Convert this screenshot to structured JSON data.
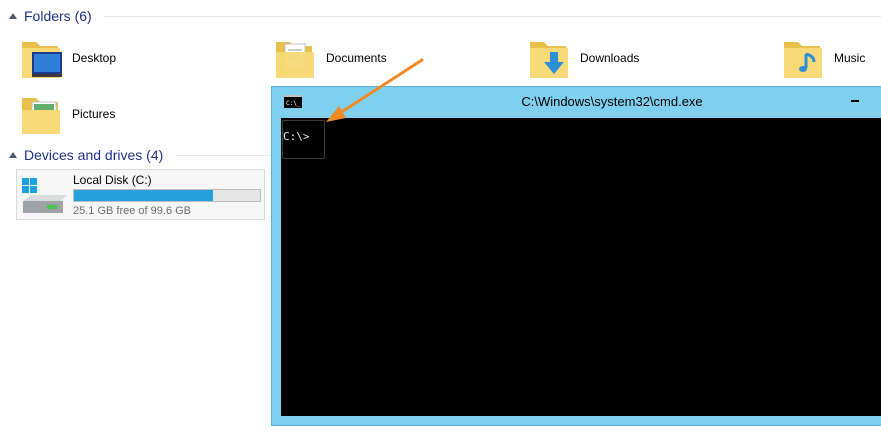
{
  "folders_section": {
    "header": "Folders (6)",
    "items": [
      {
        "name": "Desktop",
        "icon": "folder-desktop-icon"
      },
      {
        "name": "Documents",
        "icon": "folder-documents-icon"
      },
      {
        "name": "Downloads",
        "icon": "folder-downloads-icon"
      },
      {
        "name": "Music",
        "icon": "folder-music-icon"
      },
      {
        "name": "Pictures",
        "icon": "folder-pictures-icon"
      }
    ]
  },
  "drives_section": {
    "header": "Devices and drives (4)",
    "drive": {
      "name": "Local Disk (C:)",
      "free_text": "25.1 GB free of 99.6 GB",
      "used_fraction": 0.748,
      "icon": "hard-drive-icon"
    }
  },
  "cmd": {
    "title": "C:\\Windows\\system32\\cmd.exe",
    "prompt": "C:\\>",
    "sys_icon": "cmd-icon"
  },
  "colors": {
    "header_text": "#1e3287",
    "window_frame": "#7fd0ee",
    "progress_fill": "#26a0da",
    "arrow": "#f08a24",
    "console_bg": "#000000"
  }
}
